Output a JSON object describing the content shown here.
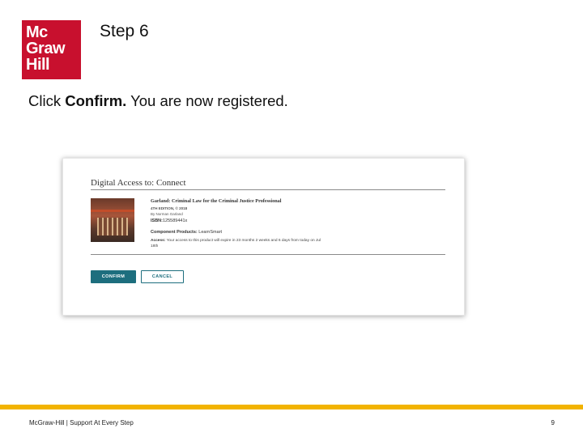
{
  "logo": {
    "line1": "Mc",
    "line2": "Graw",
    "line3": "Hill"
  },
  "slide": {
    "title": "Step 6",
    "instruction_prefix": "Click ",
    "instruction_bold": "Confirm.",
    "instruction_suffix": " You are now registered."
  },
  "screenshot": {
    "heading": "Digital Access to: Connect",
    "product_title": "Garland: Criminal Law for the Criminal Justice Professional",
    "edition": "4TH EDITION, © 2018",
    "author": "By Norman Garland",
    "isbn_label": "ISBN:",
    "isbn_value": "125589441x",
    "component_label": "Component Products:",
    "component_value": "LearnSmart",
    "access_label": "Access:",
    "access_text": "Your access to this product will expire in 23 months 2 weeks and 6 days from today on Jul 18th",
    "confirm_label": "CONFIRM",
    "cancel_label": "CANCEL",
    "accent_color": "#1d6e7e"
  },
  "footer": {
    "text": "McGraw-Hill  |  Support At Every Step",
    "page": "9",
    "bar_color": "#f2b300"
  }
}
